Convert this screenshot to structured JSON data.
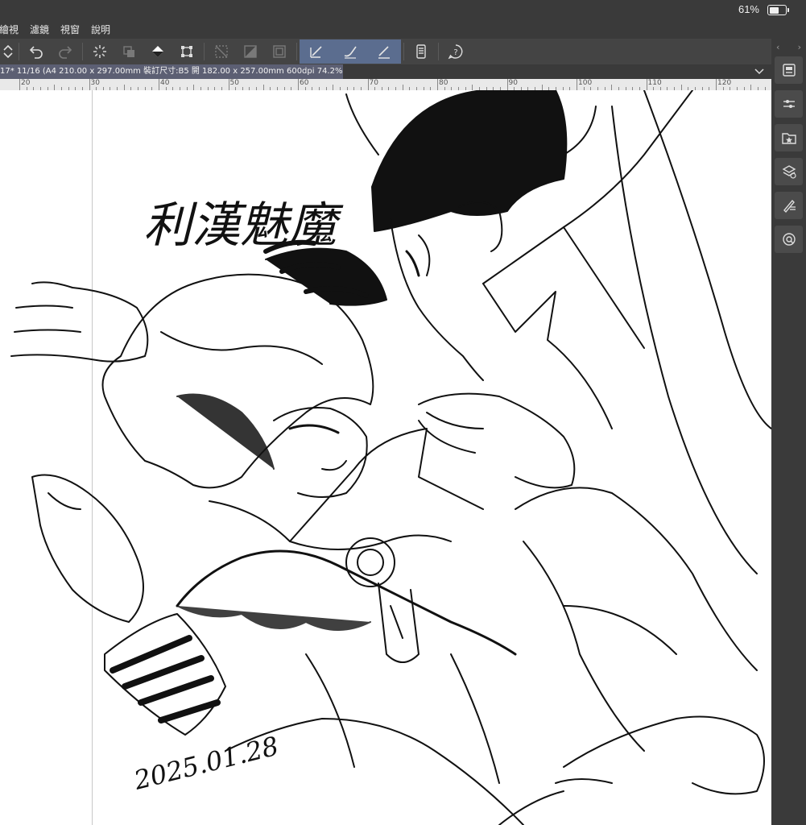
{
  "status": {
    "battery_percent": "61%",
    "battery_level": 0.61
  },
  "menu": {
    "items": [
      "繪視",
      "濾鏡",
      "視窗",
      "說明"
    ]
  },
  "toolbar": {
    "buttons": [
      "chevron-updown-icon",
      "undo-icon",
      "redo-icon",
      "loading-icon",
      "transform-icon",
      "fill-icon",
      "transform-handles-icon",
      "clear-selection-icon",
      "selection-fill-icon",
      "selection-border-icon",
      "vector-correct-icon",
      "stroke-stabilize-icon",
      "pen-pressure-icon",
      "device-icon",
      "help-icon"
    ]
  },
  "document_tab": {
    "label": "17* 11/16 (A4 210.00 x 297.00mm 裝訂尺寸:B5 開 182.00 x 257.00mm 600dpi 74.2%)"
  },
  "ruler": {
    "labels": [
      "20",
      "30",
      "40",
      "50",
      "60",
      "70",
      "80",
      "90",
      "100",
      "110",
      "120"
    ]
  },
  "artwork": {
    "title_calligraphy": "利漢魅魔",
    "date_signature": "2025.01.28"
  },
  "right_panel": {
    "buttons": [
      "layer-panel-icon",
      "tool-property-icon",
      "material-icon",
      "layer-properties-icon",
      "subview-icon",
      "navigator-icon"
    ]
  },
  "colors": {
    "accent": "#5b6d8f",
    "tab_bg": "#5c5f73",
    "toolbar_bg": "#444444",
    "chrome_bg": "#3a3a3a"
  }
}
